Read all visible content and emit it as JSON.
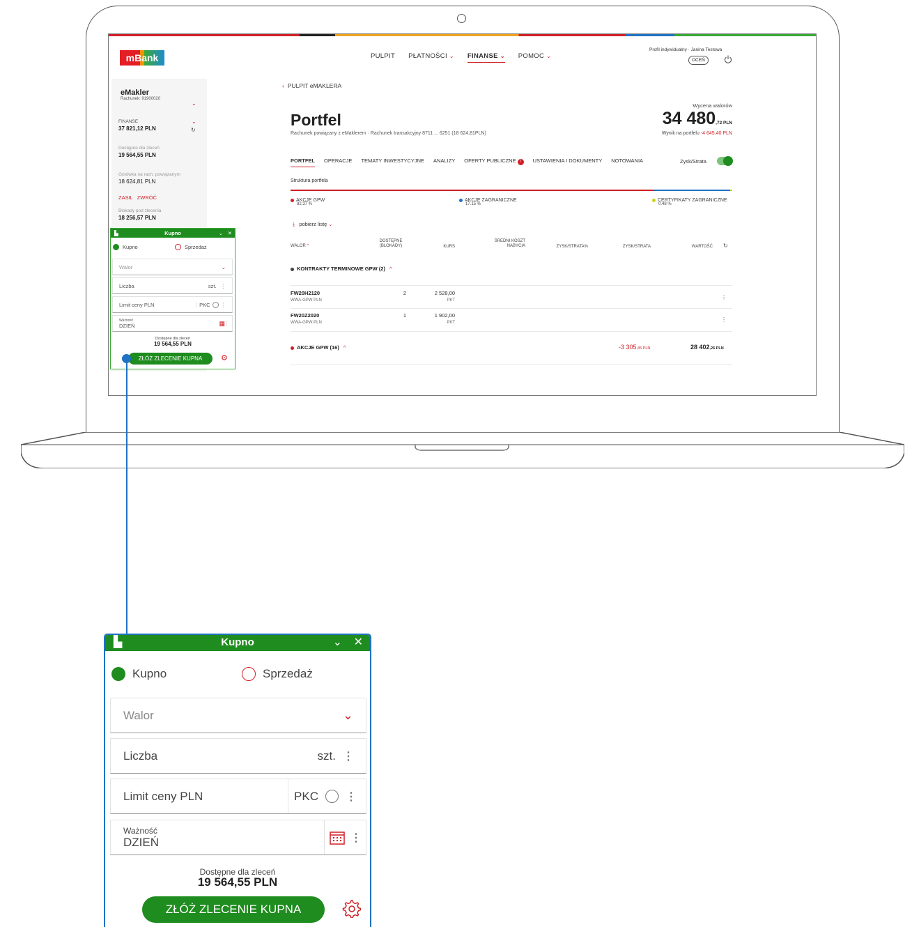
{
  "header": {
    "logo": "mBank",
    "nav": [
      {
        "label": "PULPIT",
        "has_menu": false,
        "active": false
      },
      {
        "label": "PŁATNOŚCI",
        "has_menu": true,
        "active": false
      },
      {
        "label": "FINANSE",
        "has_menu": true,
        "active": true
      },
      {
        "label": "POMOC",
        "has_menu": true,
        "active": false
      }
    ],
    "profile": "Profil indywidualny · Janina Testowa",
    "ocen": "OCEŃ"
  },
  "sidebar": {
    "title": "eMakler",
    "account": "Rachunek: 91900020",
    "finanse_label": "FINANSE",
    "finanse_value": "37 821,12 PLN",
    "dostepne_label": "Dostępne dla zleceń",
    "dostepne_value": "19 564,55 PLN",
    "gotowka_label": "Gotówka na rach. powiązanym",
    "gotowka_value": "18 624,81 PLN",
    "zasil": "ZASIL",
    "zwroc": "ZWRÓĆ",
    "blokady_label": "Blokady pod zlecenia",
    "blokady_value": "18 256,57 PLN"
  },
  "main": {
    "back": "PULPIT eMAKLERA",
    "title": "Portfel",
    "subtitle": "Rachunek powiązany z eMaklerem · Rachunek transakcyjny 8711 ... 6251 (18 624,81PLN)",
    "wycena_label": "Wycena walorów",
    "wycena_main": "34 480",
    "wycena_small": ",72 PLN",
    "wynik_label": "Wynik na portfelu",
    "wynik_value": "-4 645,40 PLN",
    "tabs": [
      "PORTFEL",
      "OPERACJE",
      "TEMATY INWESTYCYJNE",
      "ANALIZY",
      "OFERTY PUBLICZNE",
      "USTAWIENIA I DOKUMENTY",
      "NOTOWANIA"
    ],
    "tab_badge": "!",
    "zysk_toggle": "Zysk/Strata",
    "struktura": "Struktura portfela",
    "structure": [
      {
        "name": "AKCJE GPW",
        "pct": "82.37 %",
        "color": "#d01f26",
        "share": 82.37
      },
      {
        "name": "AKCJE ZAGRANICZNE",
        "pct": "17.15 %",
        "color": "#1f72c4",
        "share": 17.15
      },
      {
        "name": "CERTYFIKATY ZAGRANICZNE",
        "pct": "0.48 %",
        "color": "#c8d21e",
        "share": 0.48
      }
    ],
    "pobierz": "pobierz listę",
    "columns": {
      "walor": "WALOR",
      "dostepne": "DOSTĘPNE",
      "blokady": "(BLOKADY)",
      "kurs": "KURS",
      "sredni": "ŚREDNI KOSZT",
      "nabycia": "NABYCIA",
      "zysk_pct": "ZYSK/STRATA%",
      "zysk": "ZYSK/STRATA",
      "wartosc": "WARTOŚĆ"
    },
    "group1": "KONTRAKTY TERMINOWE GPW (2)",
    "rows": [
      {
        "code": "FW20H2120",
        "market": "WWA-GPW PLN",
        "qty": "2",
        "kurs": "2 528,00",
        "unit": "PKT"
      },
      {
        "code": "FW20Z2020",
        "market": "WWA-GPW PLN",
        "qty": "1",
        "kurs": "1 902,00",
        "unit": "PKT"
      }
    ],
    "group2": "AKCJE GPW (16)",
    "group2_zysk": "-3 305",
    "group2_zysk_small": ",45 PLN",
    "group2_wartosc": "28 402",
    "group2_wartosc_small": ",26 PLN"
  },
  "order": {
    "title": "Kupno",
    "buy": "Kupno",
    "sell": "Sprzedaż",
    "walor": "Walor",
    "liczba": "Liczba",
    "szt": "szt.",
    "limit": "Limit ceny PLN",
    "pkc": "PKC",
    "waznosc_label": "Ważność",
    "waznosc_value": "DZIEŃ",
    "dostepne_label": "Dostępne dla zleceń",
    "dostepne_value": "19 564,55 PLN",
    "submit": "ZŁÓŻ ZLECENIE KUPNA"
  },
  "colors": {
    "green": "#1e8c1e",
    "red": "#d01f26",
    "blue": "#1f72c4"
  }
}
